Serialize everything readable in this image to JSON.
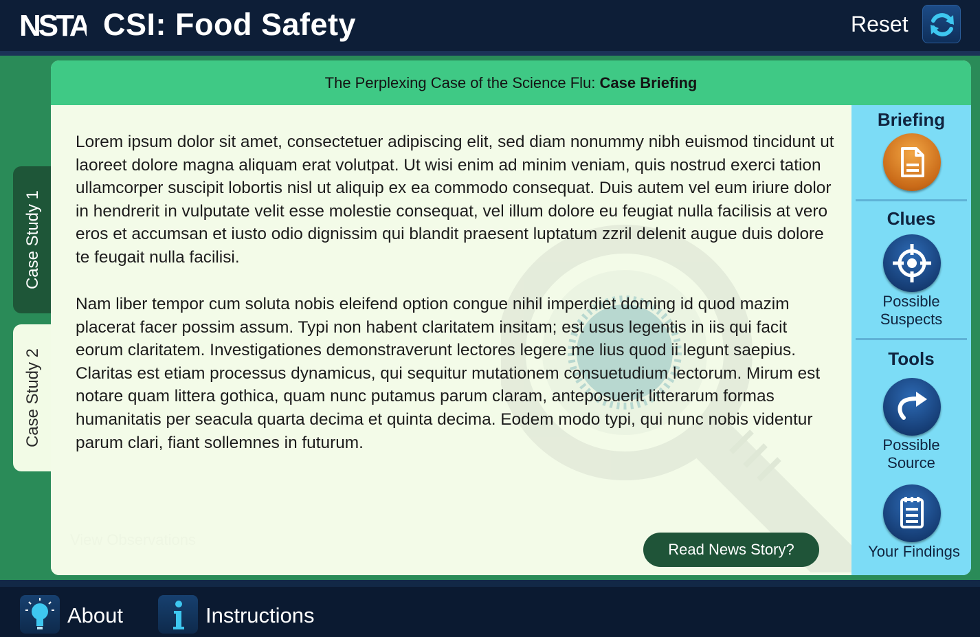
{
  "header": {
    "logo_text": "NSTA",
    "title": "CSI: Food Safety",
    "reset_label": "Reset",
    "reset_icon": "refresh-icon"
  },
  "tabs": [
    {
      "label": "Case Study 1",
      "active": false
    },
    {
      "label": "Case Study 2",
      "active": true
    }
  ],
  "panel": {
    "title_prefix": "The Perplexing Case of the Science Flu: ",
    "title_bold": "Case Briefing",
    "paragraphs": [
      "Lorem ipsum dolor sit amet, consectetuer adipiscing elit, sed diam nonummy nibh euismod tincidunt ut laoreet dolore magna aliquam erat volutpat. Ut wisi enim ad minim veniam, quis nostrud exerci tation ullamcorper suscipit lobortis nisl ut aliquip ex ea commodo consequat. Duis autem vel eum iriure dolor in hendrerit in vulputate velit esse molestie consequat, vel illum dolore eu feugiat nulla facilisis at vero eros et accumsan et iusto odio dignissim qui blandit praesent luptatum zzril delenit augue duis dolore te feugait nulla facilisi.",
      "Nam liber tempor cum soluta nobis eleifend option congue nihil imperdiet doming id quod mazim placerat facer possim assum. Typi non habent claritatem insitam; est usus legentis in iis qui facit eorum claritatem. Investigationes demonstraverunt lectores legere me lius quod ii legunt saepius. Claritas est etiam processus dynamicus, qui sequitur mutationem consuetudium lectorum. Mirum est notare quam littera gothica, quam nunc putamus parum claram, anteposuerit litterarum formas humanitatis per seacula quarta decima et quinta decima. Eodem modo typi, qui nunc nobis videntur parum clari, fiant sollemnes in futurum."
    ],
    "view_observations_label": "View Observations",
    "read_news_label": "Read News Story?"
  },
  "sidebar": {
    "briefing": {
      "title": "Briefing",
      "icon": "document-icon"
    },
    "clues": {
      "title": "Clues",
      "icon": "crosshair-icon",
      "sub_label_line1": "Possible",
      "sub_label_line2": "Suspects"
    },
    "tools": {
      "title": "Tools",
      "icon": "share-arrow-icon",
      "sub_label_line1": "Possible",
      "sub_label_line2": "Source"
    },
    "findings": {
      "icon": "clipboard-icon",
      "label": "Your Findings"
    }
  },
  "footer": {
    "about_label": "About",
    "about_icon": "lightbulb-icon",
    "instructions_label": "Instructions",
    "instructions_icon": "info-icon"
  },
  "colors": {
    "top_bar": "#0d1e37",
    "stage_green": "#2a8b58",
    "header_green": "#3fc985",
    "panel_bg": "#f3fbe8",
    "sidebar_blue": "#7cdcf6",
    "button_dark_green": "#1f5438",
    "briefing_orange": "#e08a2c",
    "icon_blue": "#163e76"
  }
}
